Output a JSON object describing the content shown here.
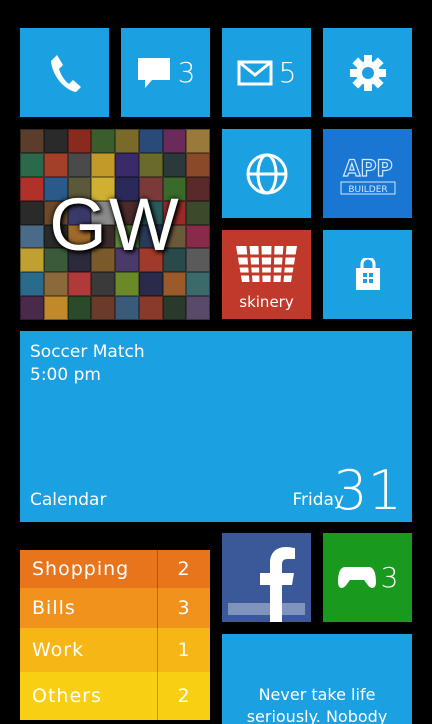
{
  "tiles": {
    "phone": {
      "icon": "phone-icon"
    },
    "messaging": {
      "icon": "chat-bubble-icon",
      "count": "3"
    },
    "mail": {
      "icon": "mail-icon",
      "count": "5"
    },
    "settings": {
      "icon": "gear-icon"
    },
    "games_hub": {
      "label": "GW"
    },
    "internet_explorer": {
      "icon": "globe-icon"
    },
    "app_builder": {
      "line1": "APP",
      "line2": "BUILDER"
    },
    "skinery": {
      "label": "skinery",
      "color": "#c0392b"
    },
    "store": {
      "icon": "shopping-bag-icon"
    },
    "calendar": {
      "event": "Soccer Match",
      "time": "5:00 pm",
      "app_name": "Calendar",
      "day": "Friday",
      "date": "31"
    },
    "todo_list": {
      "items": [
        {
          "label": "Shopping",
          "count": "2",
          "color": "#e8741c"
        },
        {
          "label": "Bills",
          "count": "3",
          "color": "#f0921c"
        },
        {
          "label": "Work",
          "count": "1",
          "color": "#f6b615"
        },
        {
          "label": "Others",
          "count": "2",
          "color": "#f8cf12"
        }
      ]
    },
    "facebook": {
      "icon": "facebook-f-icon",
      "color": "#3b5998"
    },
    "xbox_games": {
      "icon": "gamepad-icon",
      "count": "3",
      "color": "#199a1f"
    },
    "quote": {
      "text_line1": "Never take life",
      "text_line2": "seriously. Nobody"
    }
  },
  "colors": {
    "accent": "#1ba1e2",
    "background": "#000000"
  }
}
